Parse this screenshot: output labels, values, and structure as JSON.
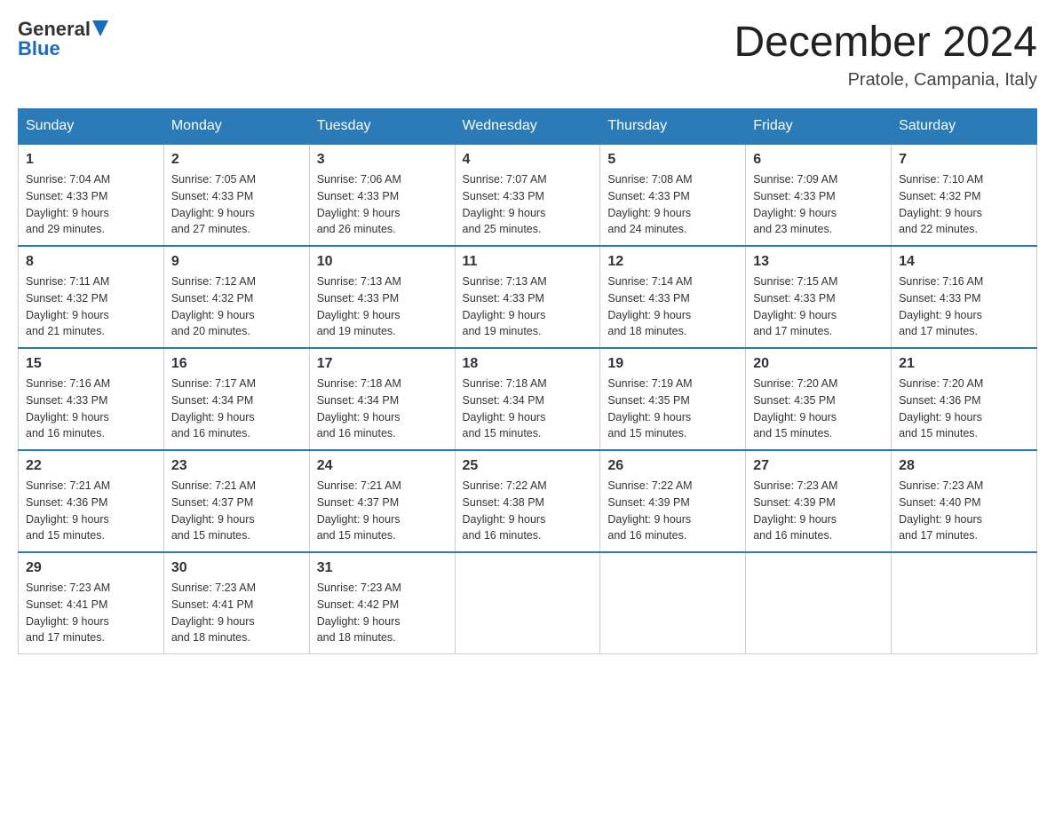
{
  "header": {
    "logo_general": "General",
    "logo_blue": "Blue",
    "month_title": "December 2024",
    "location": "Pratole, Campania, Italy"
  },
  "days_of_week": [
    "Sunday",
    "Monday",
    "Tuesday",
    "Wednesday",
    "Thursday",
    "Friday",
    "Saturday"
  ],
  "weeks": [
    [
      {
        "day": "1",
        "sunrise": "7:04 AM",
        "sunset": "4:33 PM",
        "daylight": "9 hours and 29 minutes."
      },
      {
        "day": "2",
        "sunrise": "7:05 AM",
        "sunset": "4:33 PM",
        "daylight": "9 hours and 27 minutes."
      },
      {
        "day": "3",
        "sunrise": "7:06 AM",
        "sunset": "4:33 PM",
        "daylight": "9 hours and 26 minutes."
      },
      {
        "day": "4",
        "sunrise": "7:07 AM",
        "sunset": "4:33 PM",
        "daylight": "9 hours and 25 minutes."
      },
      {
        "day": "5",
        "sunrise": "7:08 AM",
        "sunset": "4:33 PM",
        "daylight": "9 hours and 24 minutes."
      },
      {
        "day": "6",
        "sunrise": "7:09 AM",
        "sunset": "4:33 PM",
        "daylight": "9 hours and 23 minutes."
      },
      {
        "day": "7",
        "sunrise": "7:10 AM",
        "sunset": "4:32 PM",
        "daylight": "9 hours and 22 minutes."
      }
    ],
    [
      {
        "day": "8",
        "sunrise": "7:11 AM",
        "sunset": "4:32 PM",
        "daylight": "9 hours and 21 minutes."
      },
      {
        "day": "9",
        "sunrise": "7:12 AM",
        "sunset": "4:32 PM",
        "daylight": "9 hours and 20 minutes."
      },
      {
        "day": "10",
        "sunrise": "7:13 AM",
        "sunset": "4:33 PM",
        "daylight": "9 hours and 19 minutes."
      },
      {
        "day": "11",
        "sunrise": "7:13 AM",
        "sunset": "4:33 PM",
        "daylight": "9 hours and 19 minutes."
      },
      {
        "day": "12",
        "sunrise": "7:14 AM",
        "sunset": "4:33 PM",
        "daylight": "9 hours and 18 minutes."
      },
      {
        "day": "13",
        "sunrise": "7:15 AM",
        "sunset": "4:33 PM",
        "daylight": "9 hours and 17 minutes."
      },
      {
        "day": "14",
        "sunrise": "7:16 AM",
        "sunset": "4:33 PM",
        "daylight": "9 hours and 17 minutes."
      }
    ],
    [
      {
        "day": "15",
        "sunrise": "7:16 AM",
        "sunset": "4:33 PM",
        "daylight": "9 hours and 16 minutes."
      },
      {
        "day": "16",
        "sunrise": "7:17 AM",
        "sunset": "4:34 PM",
        "daylight": "9 hours and 16 minutes."
      },
      {
        "day": "17",
        "sunrise": "7:18 AM",
        "sunset": "4:34 PM",
        "daylight": "9 hours and 16 minutes."
      },
      {
        "day": "18",
        "sunrise": "7:18 AM",
        "sunset": "4:34 PM",
        "daylight": "9 hours and 15 minutes."
      },
      {
        "day": "19",
        "sunrise": "7:19 AM",
        "sunset": "4:35 PM",
        "daylight": "9 hours and 15 minutes."
      },
      {
        "day": "20",
        "sunrise": "7:20 AM",
        "sunset": "4:35 PM",
        "daylight": "9 hours and 15 minutes."
      },
      {
        "day": "21",
        "sunrise": "7:20 AM",
        "sunset": "4:36 PM",
        "daylight": "9 hours and 15 minutes."
      }
    ],
    [
      {
        "day": "22",
        "sunrise": "7:21 AM",
        "sunset": "4:36 PM",
        "daylight": "9 hours and 15 minutes."
      },
      {
        "day": "23",
        "sunrise": "7:21 AM",
        "sunset": "4:37 PM",
        "daylight": "9 hours and 15 minutes."
      },
      {
        "day": "24",
        "sunrise": "7:21 AM",
        "sunset": "4:37 PM",
        "daylight": "9 hours and 15 minutes."
      },
      {
        "day": "25",
        "sunrise": "7:22 AM",
        "sunset": "4:38 PM",
        "daylight": "9 hours and 16 minutes."
      },
      {
        "day": "26",
        "sunrise": "7:22 AM",
        "sunset": "4:39 PM",
        "daylight": "9 hours and 16 minutes."
      },
      {
        "day": "27",
        "sunrise": "7:23 AM",
        "sunset": "4:39 PM",
        "daylight": "9 hours and 16 minutes."
      },
      {
        "day": "28",
        "sunrise": "7:23 AM",
        "sunset": "4:40 PM",
        "daylight": "9 hours and 17 minutes."
      }
    ],
    [
      {
        "day": "29",
        "sunrise": "7:23 AM",
        "sunset": "4:41 PM",
        "daylight": "9 hours and 17 minutes."
      },
      {
        "day": "30",
        "sunrise": "7:23 AM",
        "sunset": "4:41 PM",
        "daylight": "9 hours and 18 minutes."
      },
      {
        "day": "31",
        "sunrise": "7:23 AM",
        "sunset": "4:42 PM",
        "daylight": "9 hours and 18 minutes."
      },
      null,
      null,
      null,
      null
    ]
  ],
  "labels": {
    "sunrise": "Sunrise:",
    "sunset": "Sunset:",
    "daylight": "Daylight:"
  }
}
